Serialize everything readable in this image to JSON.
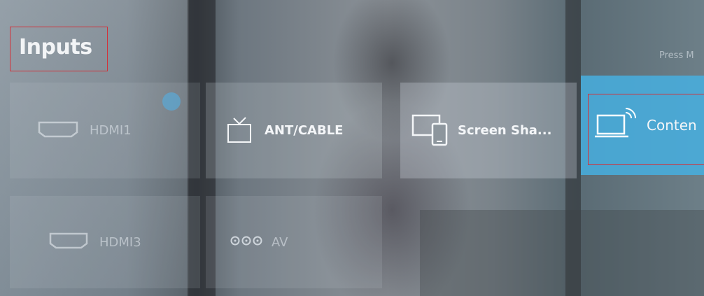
{
  "screen": {
    "title": "Inputs",
    "hint": "Press M"
  },
  "inputs": [
    {
      "label": "HDMI1",
      "icon": "hdmi-icon"
    },
    {
      "label": "ANT/CABLE",
      "icon": "tv-icon"
    },
    {
      "label": "Screen Sha...",
      "icon": "screen-share-icon"
    },
    {
      "label": "Conten",
      "icon": "content-cast-icon"
    },
    {
      "label": "HDMI3",
      "icon": "hdmi-icon"
    },
    {
      "label": "AV",
      "icon": "av-icon"
    }
  ],
  "colors": {
    "focus_tile": "#46afe1",
    "highlight_outline": "#d2323a"
  }
}
